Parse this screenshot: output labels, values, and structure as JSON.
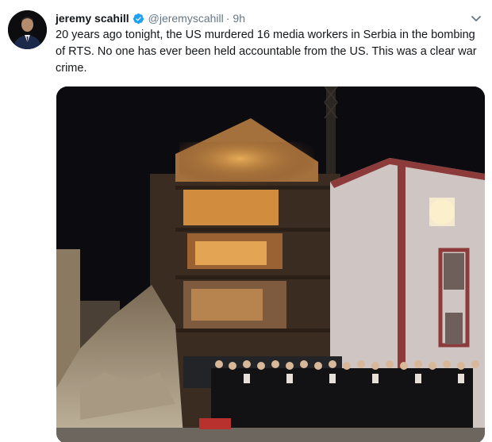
{
  "tweet": {
    "author_name": "jeremy scahill",
    "handle": "@jeremyscahill",
    "separator": "·",
    "time": "9h",
    "verified": true,
    "text": "20 years ago tonight, the US murdered 16 media workers in Serbia in the bombing of RTS. No one has ever been held accountable from the US. This was a clear war crime.",
    "menu_icon": "chevron-down-icon",
    "verified_icon": "verified-badge-icon"
  },
  "colors": {
    "text": "#14171a",
    "secondary": "#657786",
    "verified_blue": "#1da1f2",
    "night_sky": "#0c0c10",
    "warm_light": "#e8a24a"
  }
}
